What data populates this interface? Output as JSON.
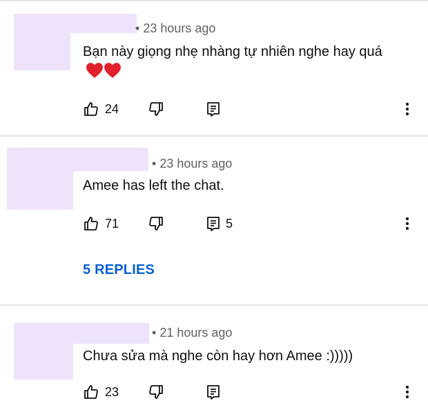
{
  "comments": [
    {
      "time": "23 hours ago",
      "text": "Bạn này giọng nhẹ nhàng tự nhiên nghe hay quá",
      "emoji": "❤️❤️",
      "likes": "24",
      "reply_count": ""
    },
    {
      "time": "23 hours ago",
      "text": "Amee has left the chat.",
      "likes": "71",
      "reply_count": "5",
      "replies_label": "5 REPLIES"
    },
    {
      "time": "21 hours ago",
      "text": "Chưa sửa mà nghe còn hay hơn Amee :)))))",
      "likes": "23",
      "reply_count": ""
    }
  ],
  "icons": {
    "like": "thumb-up-icon",
    "dislike": "thumb-down-icon",
    "reply": "reply-icon",
    "more": "more-vert-icon"
  },
  "colors": {
    "redaction": "#efe3fb",
    "link": "#065fd4",
    "meta": "#606060",
    "heart": "#e0202a"
  }
}
